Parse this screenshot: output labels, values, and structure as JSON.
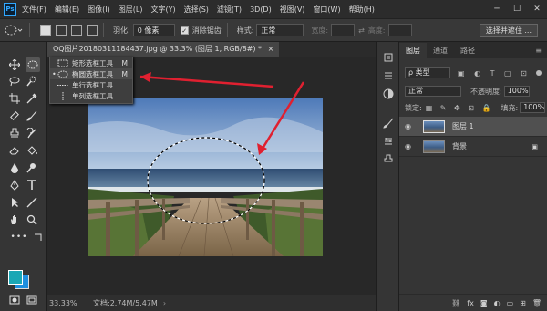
{
  "app": {
    "logo": "Ps"
  },
  "menu": [
    "文件(F)",
    "编辑(E)",
    "图像(I)",
    "图层(L)",
    "文字(Y)",
    "选择(S)",
    "滤镜(T)",
    "3D(D)",
    "视图(V)",
    "窗口(W)",
    "帮助(H)"
  ],
  "window_controls": {
    "minimize": "─",
    "maximize": "☐",
    "close": "✕"
  },
  "options": {
    "feather_label": "羽化:",
    "feather_value": "0 像素",
    "antialias_label": "消除锯齿",
    "style_label": "样式:",
    "style_value": "正常",
    "width_label": "宽度:",
    "height_label": "高度:",
    "select_mask_button": "选择并遮住 ..."
  },
  "document": {
    "tab_title": "QQ图片20180311184437.jpg @ 33.3% (图层 1, RGB/8#) *",
    "close": "×",
    "zoom": "33.33%",
    "doc_info": "文档:2.74M/5.47M"
  },
  "flyout": {
    "items": [
      {
        "label": "矩形选框工具",
        "key": "M",
        "selected": false,
        "bullet": ""
      },
      {
        "label": "椭圆选框工具",
        "key": "M",
        "selected": true,
        "bullet": "•"
      },
      {
        "label": "单行选框工具",
        "key": "",
        "selected": false,
        "bullet": ""
      },
      {
        "label": "单列选框工具",
        "key": "",
        "selected": false,
        "bullet": ""
      }
    ]
  },
  "layers_panel": {
    "tabs": [
      "图层",
      "通道",
      "路径"
    ],
    "active_tab": 0,
    "kind_filter": "ρ 类型",
    "blend_mode": "正常",
    "opacity_label": "不透明度:",
    "opacity_value": "100%",
    "lock_label": "锁定:",
    "fill_label": "填充:",
    "fill_value": "100%",
    "layers": [
      {
        "name": "图层 1",
        "selected": true,
        "locked": false
      },
      {
        "name": "背景",
        "selected": false,
        "locked": true
      }
    ],
    "bottom_icons": [
      "link-icon",
      "fx-icon",
      "mask-icon",
      "adjustment-icon",
      "group-icon",
      "new-layer-icon",
      "trash-icon"
    ]
  },
  "colors": {
    "foreground": "#1aa7b5",
    "background": "#1e8fdf",
    "arrow": "#e02030"
  },
  "icons": {
    "eye": "◉",
    "lock": "🔒"
  }
}
